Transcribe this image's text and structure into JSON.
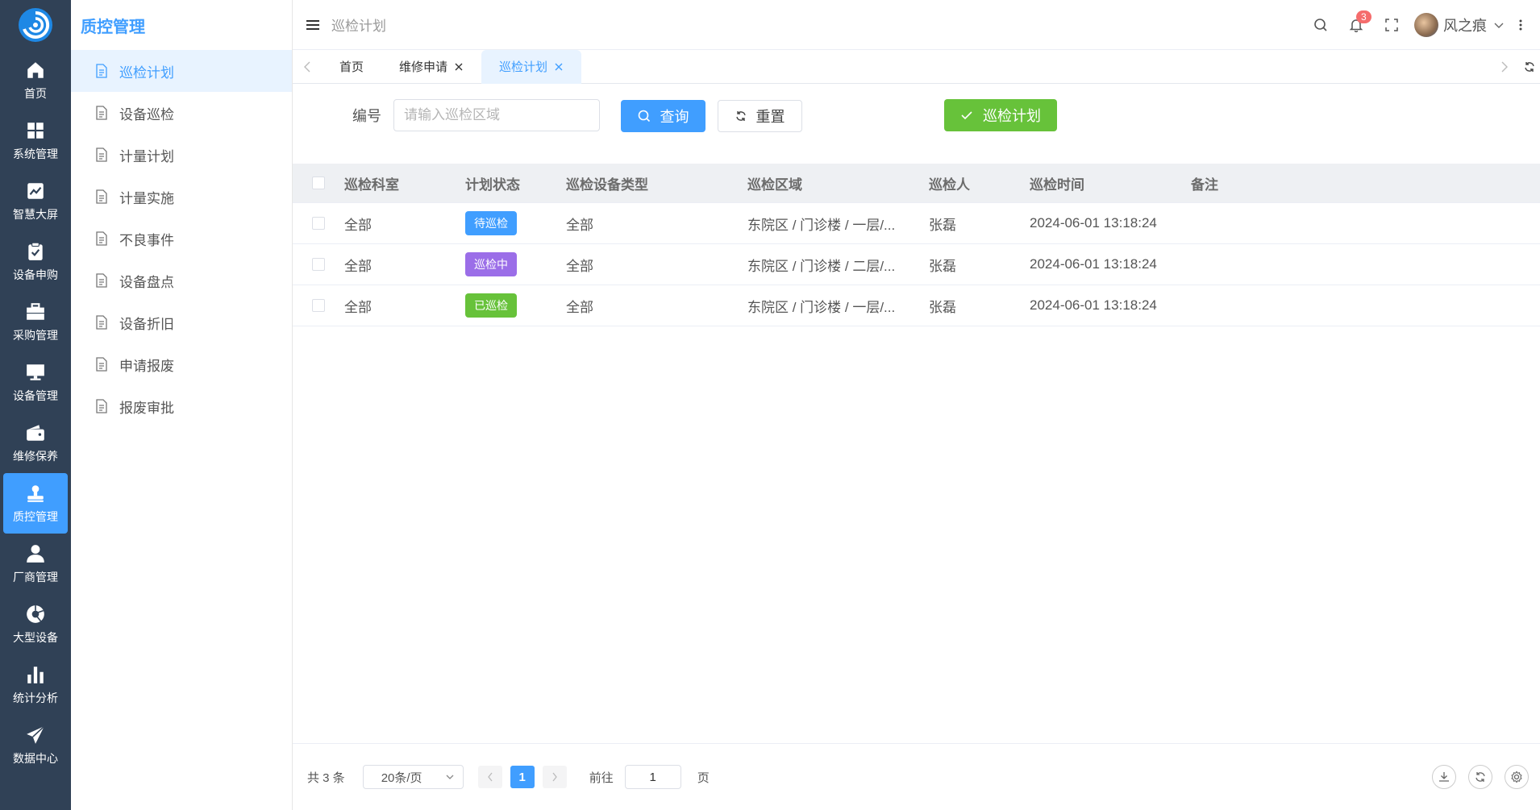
{
  "rail": {
    "items": [
      {
        "label": "首页",
        "icon": "home-icon"
      },
      {
        "label": "系统管理",
        "icon": "grid-icon"
      },
      {
        "label": "智慧大屏",
        "icon": "chart-line-icon"
      },
      {
        "label": "设备申购",
        "icon": "clipboard-check-icon"
      },
      {
        "label": "采购管理",
        "icon": "briefcase-icon"
      },
      {
        "label": "设备管理",
        "icon": "monitor-icon"
      },
      {
        "label": "维修保养",
        "icon": "wallet-icon"
      },
      {
        "label": "质控管理",
        "icon": "user-stamp-icon",
        "active": true
      },
      {
        "label": "厂商管理",
        "icon": "user-icon"
      },
      {
        "label": "大型设备",
        "icon": "aperture-icon"
      },
      {
        "label": "统计分析",
        "icon": "bar-chart-icon"
      },
      {
        "label": "数据中心",
        "icon": "send-icon"
      }
    ]
  },
  "submenu": {
    "title": "质控管理",
    "items": [
      {
        "label": "巡检计划",
        "active": true
      },
      {
        "label": "设备巡检"
      },
      {
        "label": "计量计划"
      },
      {
        "label": "计量实施"
      },
      {
        "label": "不良事件"
      },
      {
        "label": "设备盘点"
      },
      {
        "label": "设备折旧"
      },
      {
        "label": "申请报废"
      },
      {
        "label": "报废审批"
      }
    ]
  },
  "header": {
    "title": "巡检计划",
    "notification_count": "3",
    "user_name": "风之痕"
  },
  "tabs": [
    {
      "label": "首页",
      "closable": false
    },
    {
      "label": "维修申请",
      "closable": true
    },
    {
      "label": "巡检计划",
      "closable": true,
      "active": true
    }
  ],
  "filter": {
    "label": "编号",
    "placeholder": "请输入巡检区域",
    "value": "",
    "query_label": "查询",
    "reset_label": "重置",
    "plan_label": "巡检计划"
  },
  "table": {
    "columns": [
      "巡检科室",
      "计划状态",
      "巡检设备类型",
      "巡检区域",
      "巡检人",
      "巡检时间",
      "备注"
    ],
    "rows": [
      {
        "dept": "全部",
        "status": "待巡检",
        "status_color": "#409eff",
        "type": "全部",
        "area": "东院区 / 门诊楼 / 一层/...",
        "inspector": "张磊",
        "time": "2024-06-01 13:18:24",
        "note": ""
      },
      {
        "dept": "全部",
        "status": "巡检中",
        "status_color": "#9b6ee8",
        "type": "全部",
        "area": "东院区 / 门诊楼 / 二层/...",
        "inspector": "张磊",
        "time": "2024-06-01 13:18:24",
        "note": ""
      },
      {
        "dept": "全部",
        "status": "已巡检",
        "status_color": "#67c23a",
        "type": "全部",
        "area": "东院区 / 门诊楼 / 一层/...",
        "inspector": "张磊",
        "time": "2024-06-01 13:18:24",
        "note": ""
      }
    ]
  },
  "pagination": {
    "total": "共 3 条",
    "page_size": "20条/页",
    "current_page": "1",
    "goto_label": "前往",
    "goto_value": "1",
    "page_suffix": "页"
  },
  "colors": {
    "rail_bg": "#304156",
    "primary": "#409eff",
    "success": "#67c23a",
    "purple": "#9b6ee8"
  }
}
